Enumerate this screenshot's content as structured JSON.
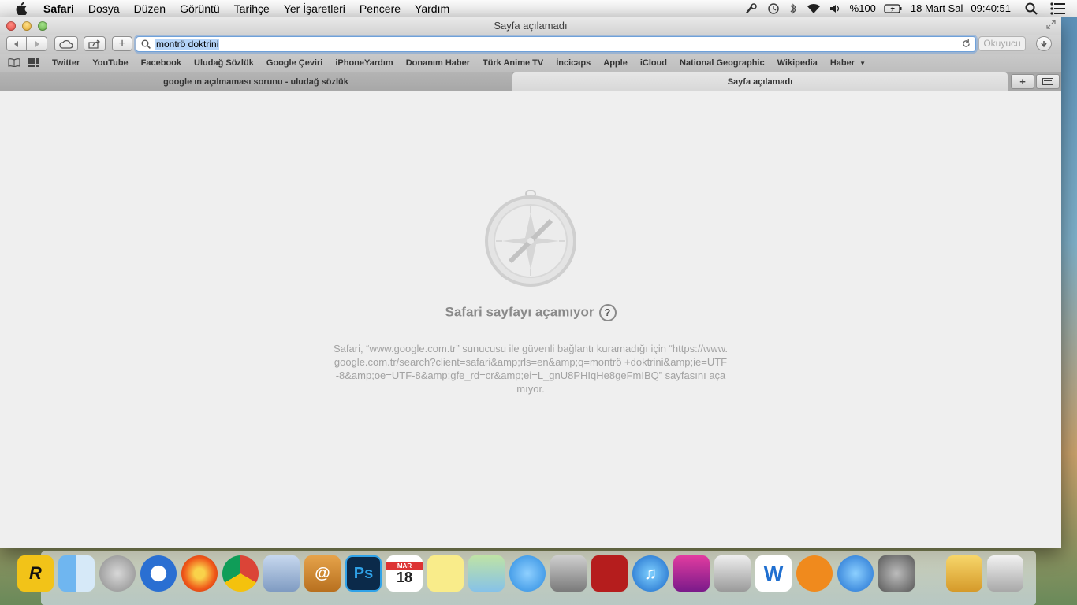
{
  "menubar": {
    "app": "Safari",
    "items": [
      "Dosya",
      "Düzen",
      "Görüntü",
      "Tarihçe",
      "Yer İşaretleri",
      "Pencere",
      "Yardım"
    ],
    "battery": "%100",
    "date": "18 Mart Sal",
    "time": "09:40:51"
  },
  "window": {
    "title": "Sayfa açılamadı",
    "address_value": "montrö doktrini",
    "reader_label": "Okuyucu"
  },
  "bookmarks": [
    "Twitter",
    "YouTube",
    "Facebook",
    "Uludağ Sözlük",
    "Google Çeviri",
    "iPhoneYardım",
    "Donanım Haber",
    "Türk Anime TV",
    "İncicaps",
    "Apple",
    "iCloud",
    "National Geographic",
    "Wikipedia",
    "Haber"
  ],
  "tabs": [
    {
      "title": "google ın açılmaması sorunu - uludağ sözlük",
      "active": false
    },
    {
      "title": "Sayfa açılamadı",
      "active": true
    }
  ],
  "error": {
    "title": "Safari sayfayı açamıyor",
    "help": "?",
    "message": "Safari, “www.google.com.tr” sunucusu ile güvenli bağlantı kuramadığı için “https://www.google.com.tr/search?client=safari&amp;rls=en&amp;q=montrö +doktrini&amp;ie=UTF-8&amp;oe=UTF-8&amp;gfe_rd=cr&amp;ei=L_gnU8PHIqHe8geFmIBQ” sayfasını açamıyor."
  },
  "dock": {
    "apps": [
      "rockstar-app",
      "finder",
      "launchpad",
      "safari",
      "firefox",
      "chrome",
      "mail",
      "contacts",
      "photoshop",
      "calendar",
      "notes",
      "maps",
      "messages",
      "facetime",
      "photo-booth",
      "itunes",
      "display",
      "image-capture",
      "word",
      "ibooks",
      "app-store",
      "system-preferences",
      "downloads",
      "trash"
    ],
    "photoshop_label": "Ps",
    "calendar_month": "MAR",
    "calendar_day": "18"
  }
}
